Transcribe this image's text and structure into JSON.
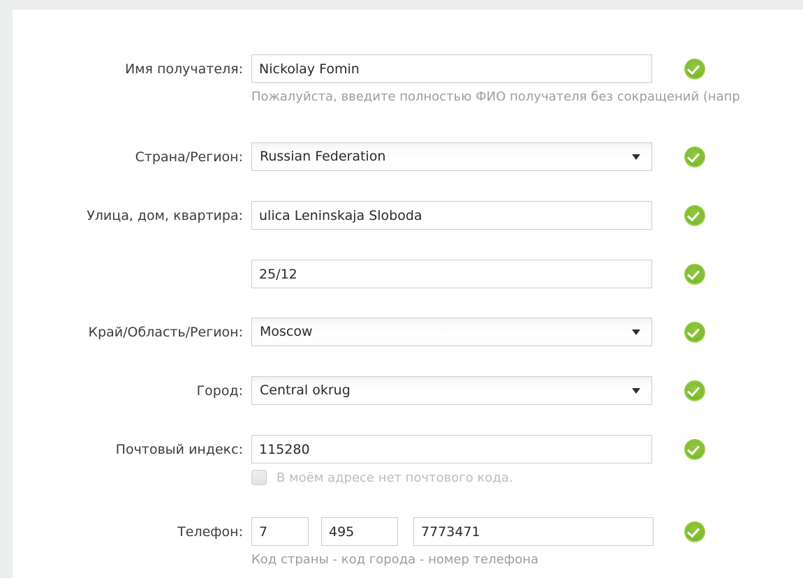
{
  "form": {
    "rows": [
      {
        "label": "Имя получателя:",
        "type": "text",
        "value": "Nickolay Fomin",
        "name": "recipient-name",
        "hint": "Пожалуйста, введите полностью ФИО получателя без сокращений (напр",
        "valid": true
      },
      {
        "label": "Страна/Регион:",
        "type": "select",
        "value": "Russian Federation",
        "name": "country-region",
        "valid": true
      },
      {
        "label": "Улица, дом, квартира:",
        "type": "text",
        "value": "ulica Leninskaja Sloboda",
        "name": "street-address-line1",
        "valid": true
      },
      {
        "label": "",
        "type": "text",
        "value": "25/12",
        "name": "street-address-line2",
        "valid": true
      },
      {
        "label": "Край/Область/Регион:",
        "type": "select",
        "value": "Moscow",
        "name": "state-province-region",
        "valid": true
      },
      {
        "label": "Город:",
        "type": "select",
        "value": "Central okrug",
        "name": "city",
        "valid": true
      },
      {
        "label": "Почтовый индекс:",
        "type": "text",
        "value": "115280",
        "name": "postal-code",
        "valid": true,
        "checkbox": {
          "label": "В моём адресе нет почтового кода.",
          "checked": false
        }
      },
      {
        "label": "Телефон:",
        "type": "phone",
        "name": "phone",
        "valid": true,
        "country_code": "7",
        "area_code": "495",
        "number": "7773471",
        "hint": "Код страны - код города - номер телефона"
      }
    ]
  },
  "icons": {
    "valid_check": "green-check-icon",
    "dropdown": "chevron-down-icon",
    "checkbox": "checkbox-icon"
  },
  "colors": {
    "valid_green": "#76b72a",
    "valid_green_light": "#8dc63f",
    "border": "#cdcdcd",
    "label_text": "#3d3d3d",
    "hint_text": "#9d9d9d",
    "disabled_text": "#bdbdbd",
    "page_bg": "#eceded",
    "content_bg": "#ffffff"
  }
}
